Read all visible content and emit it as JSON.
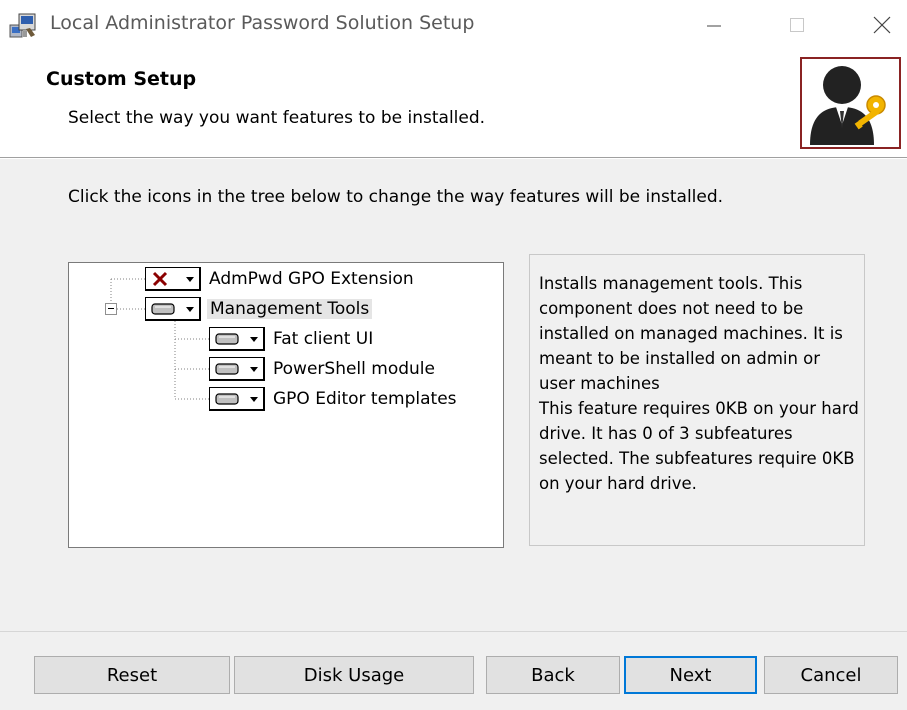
{
  "window": {
    "title": "Local Administrator Password Solution Setup"
  },
  "header": {
    "title": "Custom Setup",
    "subtitle": "Select the way you want features to be installed."
  },
  "instruction": "Click the icons in the tree below to change the way features will be installed.",
  "tree": {
    "items": [
      {
        "label": "AdmPwd GPO Extension",
        "state_icon": "x-unavailable-icon"
      },
      {
        "label": "Management Tools",
        "state_icon": "drive-icon",
        "selected": true,
        "expand_icon": "collapse-minus-icon"
      },
      {
        "label": "Fat client UI",
        "state_icon": "drive-icon"
      },
      {
        "label": "PowerShell module",
        "state_icon": "drive-icon"
      },
      {
        "label": "GPO Editor templates",
        "state_icon": "drive-icon"
      }
    ]
  },
  "description": "Installs management tools. This component does not need to be installed on managed machines. It is meant to be installed on admin or user machines\nThis feature requires 0KB on your hard drive. It has 0 of 3 subfeatures selected. The subfeatures require 0KB on your hard drive.",
  "buttons": {
    "reset": "Reset",
    "disk_usage": "Disk Usage",
    "back": "Back",
    "next": "Next",
    "cancel": "Cancel"
  },
  "colors": {
    "x_mark": "#8b0000",
    "default_button_border": "#0078d7",
    "logo_border": "#8a2323"
  }
}
